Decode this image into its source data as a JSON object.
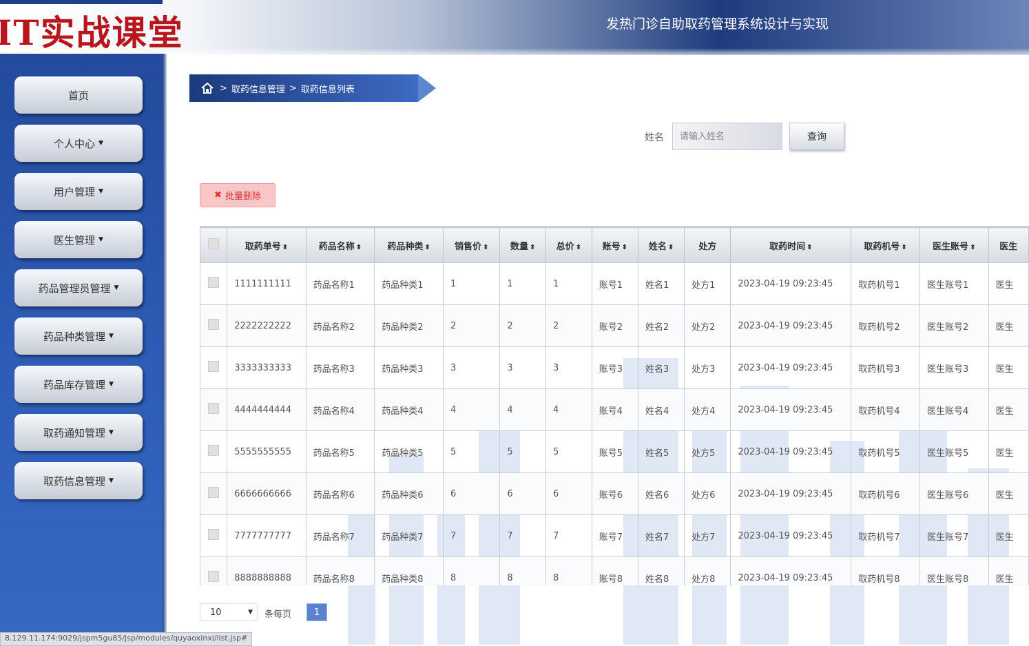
{
  "header": {
    "logo": "IT实战课堂",
    "title": "发热门诊自助取药管理系统设计与实现"
  },
  "sidebar": {
    "items": [
      {
        "label": "首页",
        "dropdown": false
      },
      {
        "label": "个人中心",
        "dropdown": true
      },
      {
        "label": "用户管理",
        "dropdown": true
      },
      {
        "label": "医生管理",
        "dropdown": true
      },
      {
        "label": "药品管理员管理",
        "dropdown": true
      },
      {
        "label": "药品种类管理",
        "dropdown": true
      },
      {
        "label": "药品库存管理",
        "dropdown": true
      },
      {
        "label": "取药通知管理",
        "dropdown": true
      },
      {
        "label": "取药信息管理",
        "dropdown": true
      }
    ]
  },
  "breadcrumb": {
    "items": [
      "取药信息管理",
      "取药信息列表"
    ],
    "separator": ">"
  },
  "search": {
    "label": "姓名",
    "placeholder": "请输入姓名",
    "button": "查询"
  },
  "actions": {
    "batch_delete": "批量删除"
  },
  "table": {
    "headers": [
      "取药单号",
      "药品名称",
      "药品种类",
      "销售价",
      "数量",
      "总价",
      "账号",
      "姓名",
      "处方",
      "取药时间",
      "取药机号",
      "医生账号",
      "医生"
    ],
    "sortable": [
      true,
      true,
      true,
      true,
      true,
      true,
      true,
      true,
      false,
      true,
      true,
      true,
      false
    ],
    "rows": [
      [
        "1111111111",
        "药品名称1",
        "药品种类1",
        "1",
        "1",
        "1",
        "账号1",
        "姓名1",
        "处方1",
        "2023-04-19 09:23:45",
        "取药机号1",
        "医生账号1",
        "医生"
      ],
      [
        "2222222222",
        "药品名称2",
        "药品种类2",
        "2",
        "2",
        "2",
        "账号2",
        "姓名2",
        "处方2",
        "2023-04-19 09:23:45",
        "取药机号2",
        "医生账号2",
        "医生"
      ],
      [
        "3333333333",
        "药品名称3",
        "药品种类3",
        "3",
        "3",
        "3",
        "账号3",
        "姓名3",
        "处方3",
        "2023-04-19 09:23:45",
        "取药机号3",
        "医生账号3",
        "医生"
      ],
      [
        "4444444444",
        "药品名称4",
        "药品种类4",
        "4",
        "4",
        "4",
        "账号4",
        "姓名4",
        "处方4",
        "2023-04-19 09:23:45",
        "取药机号4",
        "医生账号4",
        "医生"
      ],
      [
        "5555555555",
        "药品名称5",
        "药品种类5",
        "5",
        "5",
        "5",
        "账号5",
        "姓名5",
        "处方5",
        "2023-04-19 09:23:45",
        "取药机号5",
        "医生账号5",
        "医生"
      ],
      [
        "6666666666",
        "药品名称6",
        "药品种类6",
        "6",
        "6",
        "6",
        "账号6",
        "姓名6",
        "处方6",
        "2023-04-19 09:23:45",
        "取药机号6",
        "医生账号6",
        "医生"
      ],
      [
        "7777777777",
        "药品名称7",
        "药品种类7",
        "7",
        "7",
        "7",
        "账号7",
        "姓名7",
        "处方7",
        "2023-04-19 09:23:45",
        "取药机号7",
        "医生账号7",
        "医生"
      ],
      [
        "8888888888",
        "药品名称8",
        "药品种类8",
        "8",
        "8",
        "8",
        "账号8",
        "姓名8",
        "处方8",
        "2023-04-19 09:23:45",
        "取药机号8",
        "医生账号8",
        "医生"
      ]
    ]
  },
  "pagination": {
    "page_size": "10",
    "per_page_label": "条每页",
    "current_page": "1"
  },
  "status_bar": {
    "url": "8.129.11.174:9029/jspm5gu85/jsp/modules/quyaoxinxi/list.jsp#"
  }
}
